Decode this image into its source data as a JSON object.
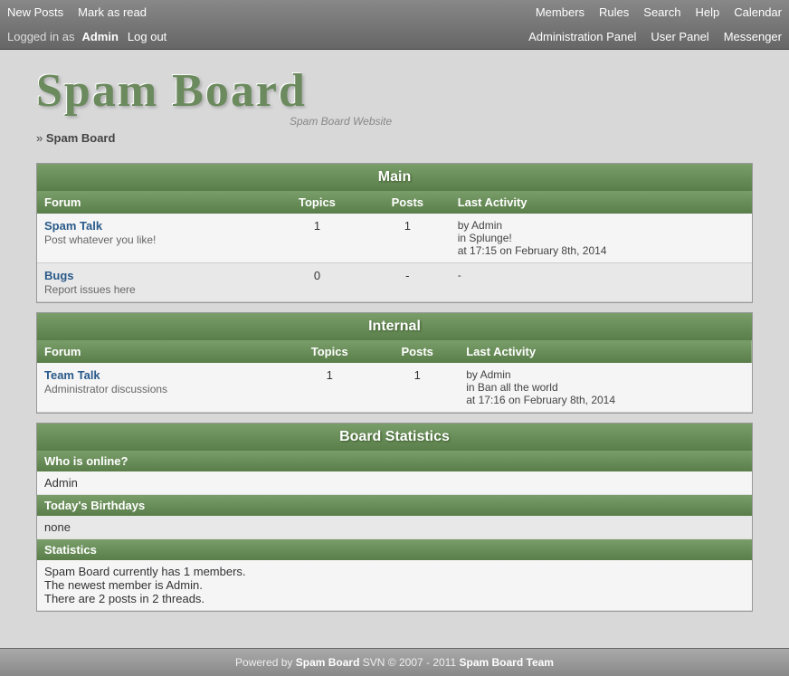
{
  "nav": {
    "left_row1": {
      "new_posts": "New Posts",
      "mark_as_read": "Mark as read"
    },
    "left_row2": {
      "logged_in_text": "Logged in as",
      "username": "Admin",
      "logout": "Log out"
    },
    "right_row1": {
      "members": "Members",
      "rules": "Rules",
      "search": "Search",
      "help": "Help",
      "calendar": "Calendar"
    },
    "right_row2": {
      "admin_panel": "Administration Panel",
      "user_panel": "User Panel",
      "messenger": "Messenger"
    }
  },
  "logo": {
    "title": "Spam Board",
    "subtitle": "Spam Board Website",
    "breadcrumb_prefix": "»",
    "breadcrumb_link": "Spam Board"
  },
  "main_section": {
    "header": "Main",
    "columns": {
      "forum": "Forum",
      "topics": "Topics",
      "posts": "Posts",
      "last_activity": "Last Activity"
    },
    "forums": [
      {
        "name": "Spam Talk",
        "description": "Post whatever you like!",
        "topics": "1",
        "posts": "1",
        "last_activity_by": "by Admin",
        "last_activity_in": "in Splunge!",
        "last_activity_time": "at 17:15 on February 8th, 2014"
      },
      {
        "name": "Bugs",
        "description": "Report issues here",
        "topics": "0",
        "posts": "-",
        "last_activity_by": "",
        "last_activity_in": "",
        "last_activity_time": ""
      }
    ]
  },
  "internal_section": {
    "header": "Internal",
    "columns": {
      "forum": "Forum",
      "topics": "Topics",
      "posts": "Posts",
      "last_activity": "Last Activity"
    },
    "forums": [
      {
        "name": "Team Talk",
        "description": "Administrator discussions",
        "topics": "1",
        "posts": "1",
        "last_activity_by": "by Admin",
        "last_activity_in": "in Ban all the world",
        "last_activity_time": "at 17:16 on February 8th, 2014"
      }
    ]
  },
  "stats_section": {
    "header": "Board Statistics",
    "online_header": "Who is online?",
    "online_users": "Admin",
    "birthdays_header": "Today's Birthdays",
    "birthdays": "none",
    "statistics_header": "Statistics",
    "stats_lines": [
      "Spam Board currently has 1 members.",
      "The newest member is Admin.",
      "There are 2 posts in 2 threads."
    ]
  },
  "footer": {
    "powered_by": "Powered by",
    "app_name": "Spam Board",
    "svn": "SVN © 2007 - 2011",
    "team": "Spam Board Team"
  }
}
